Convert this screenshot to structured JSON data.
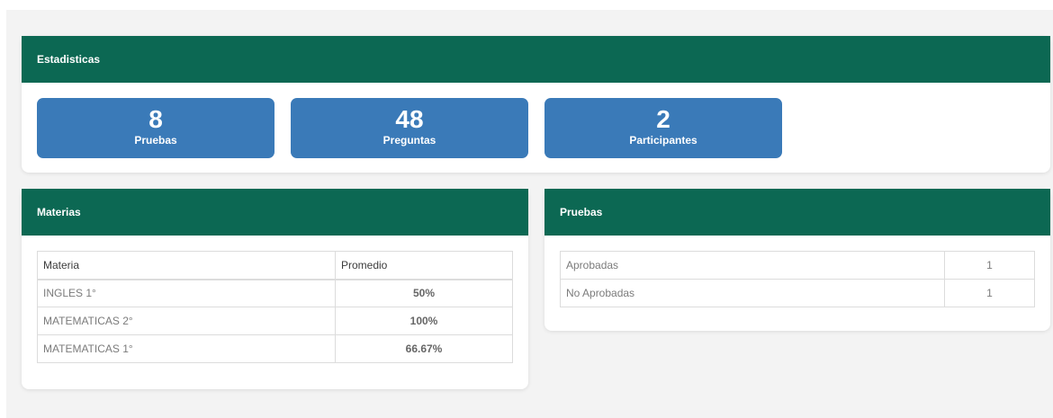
{
  "statistics": {
    "title": "Estadisticas",
    "cards": [
      {
        "value": "8",
        "label": "Pruebas"
      },
      {
        "value": "48",
        "label": "Preguntas"
      },
      {
        "value": "2",
        "label": "Participantes"
      }
    ]
  },
  "subjects": {
    "title": "Materias",
    "columns": [
      "Materia",
      "Promedio"
    ],
    "rows": [
      {
        "name": "INGLES 1°",
        "average": "50%"
      },
      {
        "name": "MATEMATICAS 2°",
        "average": "100%"
      },
      {
        "name": "MATEMATICAS 1°",
        "average": "66.67%"
      }
    ]
  },
  "tests": {
    "title": "Pruebas",
    "rows": [
      {
        "label": "Aprobadas",
        "count": "1"
      },
      {
        "label": "No Aprobadas",
        "count": "1"
      }
    ]
  },
  "colors": {
    "header_green": "#0c6853",
    "stat_blue": "#3a7ab8"
  }
}
